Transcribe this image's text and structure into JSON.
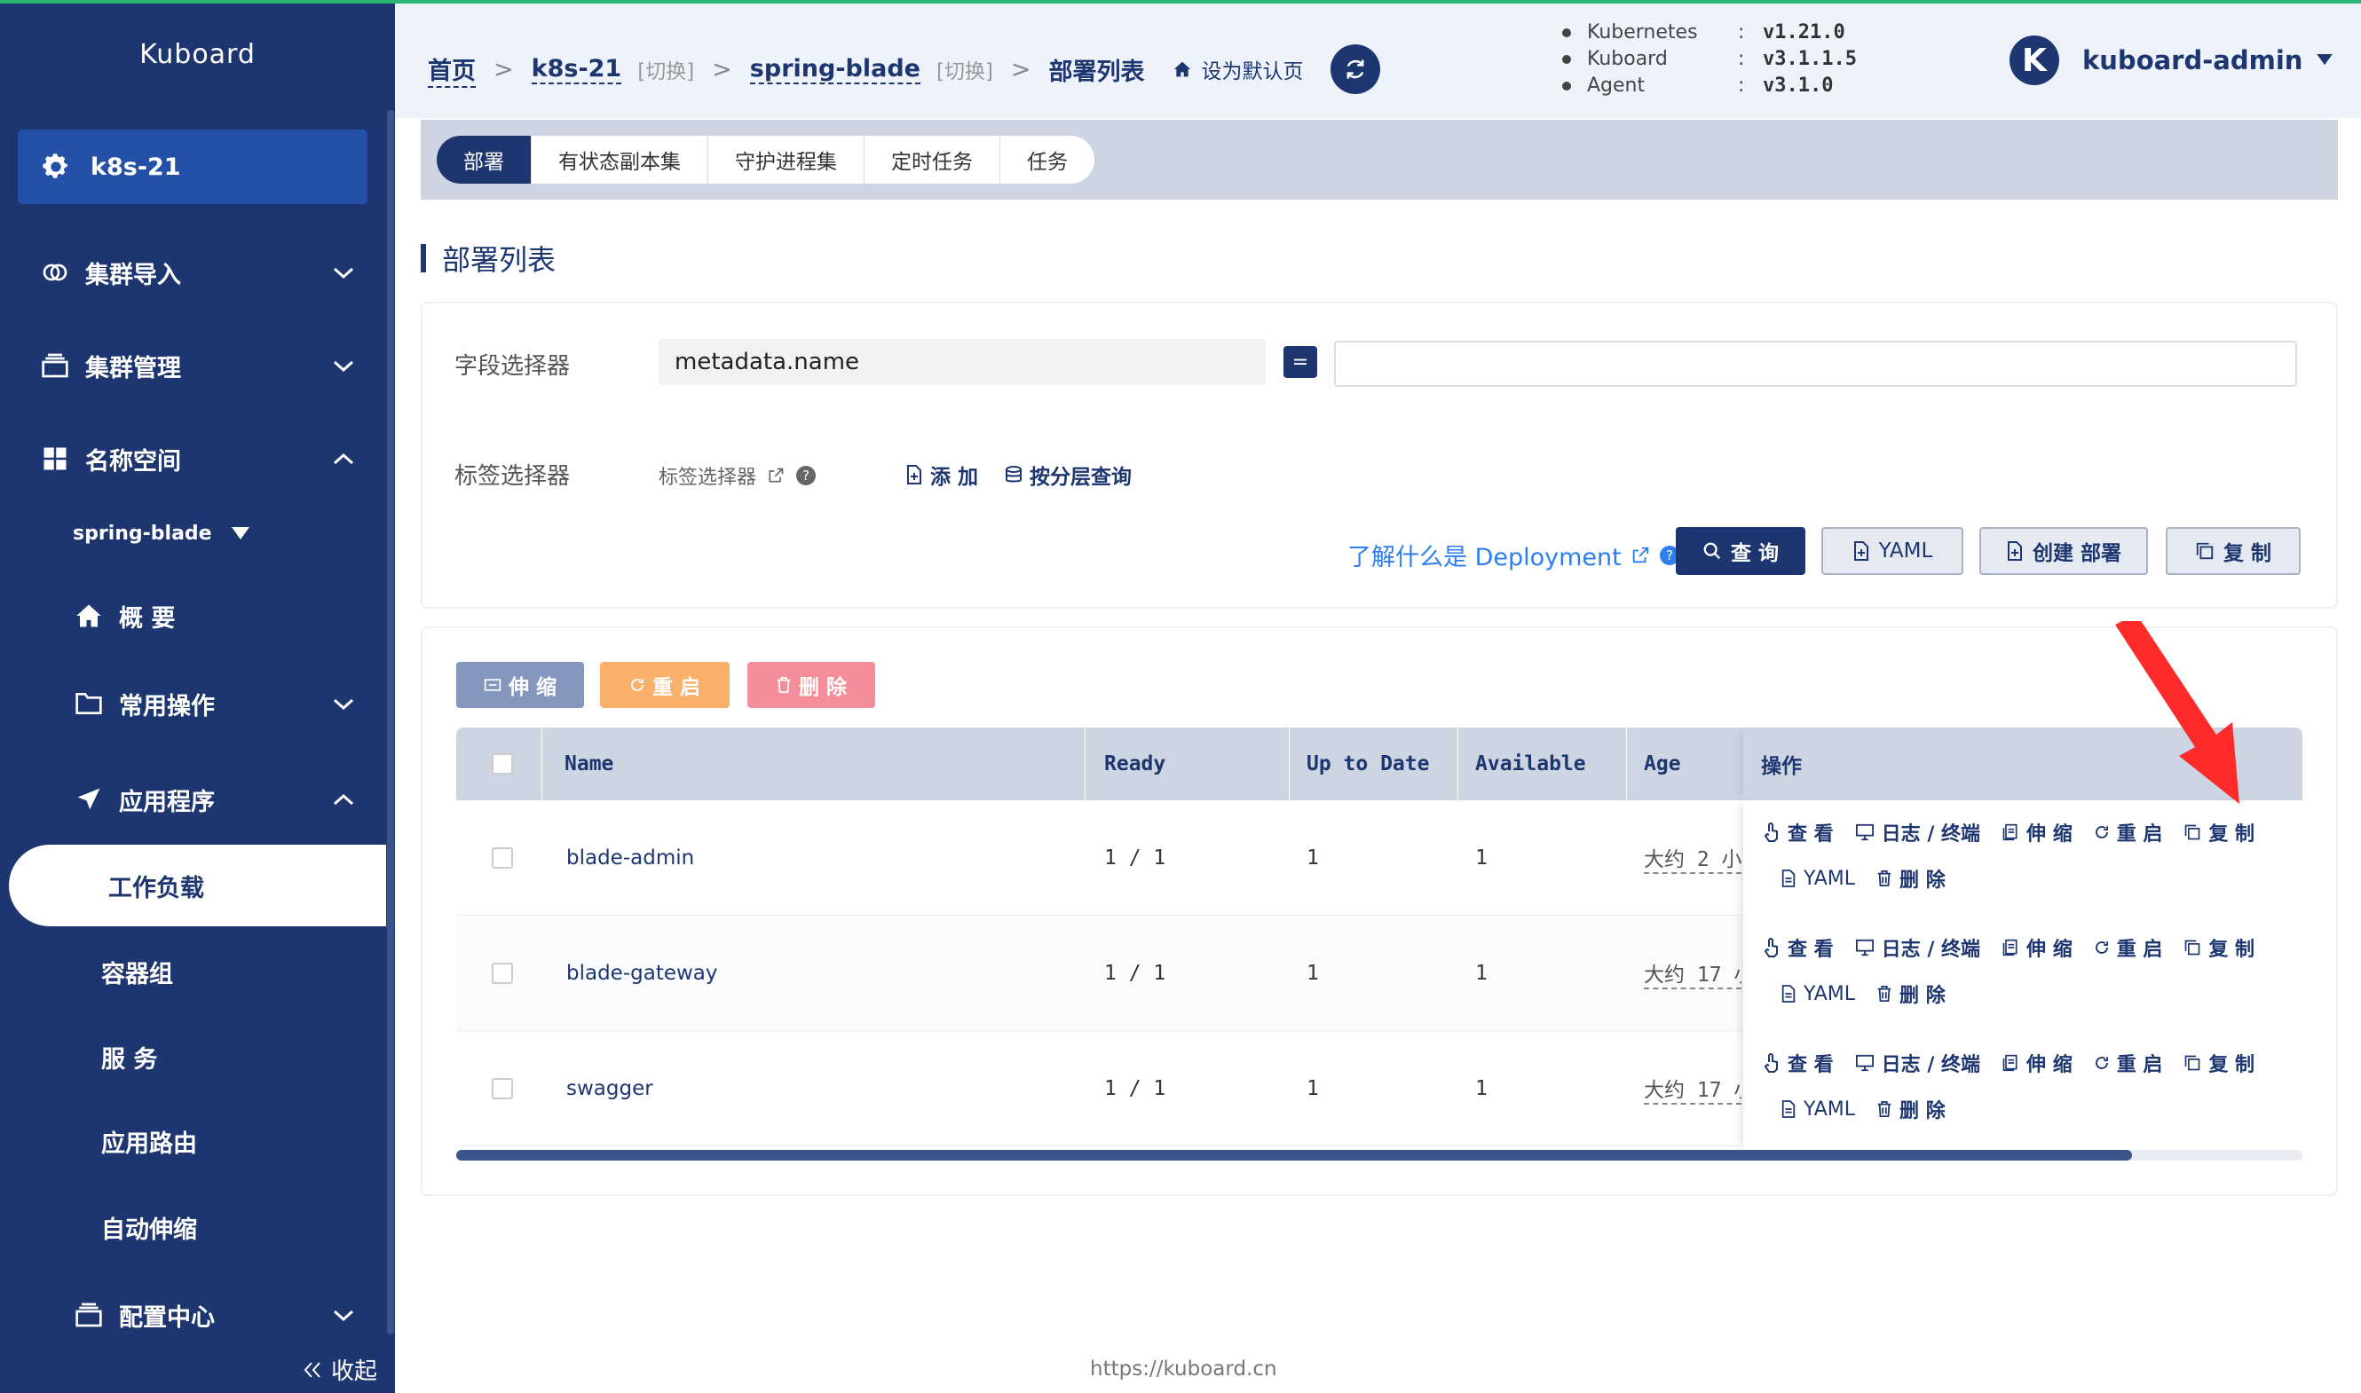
{
  "app": {
    "brand": "Kuboard",
    "cluster": "k8s-21",
    "footer": "https://kuboard.cn"
  },
  "sidebar": {
    "items": [
      {
        "label": "集群导入",
        "icon": "link-icon"
      },
      {
        "label": "集群管理",
        "icon": "stack-icon"
      },
      {
        "label": "名称空间",
        "icon": "grid-icon"
      }
    ],
    "namespace": "spring-blade",
    "ns_items": [
      {
        "label": "概 要",
        "icon": "home-icon"
      },
      {
        "label": "常用操作",
        "icon": "folder-icon"
      },
      {
        "label": "应用程序",
        "icon": "send-icon"
      }
    ],
    "app_items": [
      "工作负载",
      "容器组",
      "服 务",
      "应用路由",
      "自动伸缩"
    ],
    "config_center": "配置中心",
    "collapse": "收起"
  },
  "breadcrumb": {
    "home": "首页",
    "cluster": "k8s-21",
    "switch": "[切换]",
    "namespace": "spring-blade",
    "current": "部署列表",
    "set_default": "设为默认页"
  },
  "versions": [
    {
      "name": "Kubernetes",
      "value": "v1.21.0"
    },
    {
      "name": "Kuboard",
      "value": "v3.1.1.5"
    },
    {
      "name": "Agent",
      "value": "v3.1.0"
    }
  ],
  "user": {
    "initial": "K",
    "name": "kuboard-admin"
  },
  "tabs": [
    "部署",
    "有状态副本集",
    "守护进程集",
    "定时任务",
    "任务"
  ],
  "page_title": "部署列表",
  "filter": {
    "field_label": "字段选择器",
    "field_value": "metadata.name",
    "eq": "=",
    "tag_label": "标签选择器",
    "tag_placeholder": "标签选择器",
    "add": "添 加",
    "layered": "按分层查询",
    "learn": "了解什么是 Deployment",
    "query": "查 询",
    "yaml": "YAML",
    "create": "创建 部署",
    "copy": "复 制"
  },
  "bulk": {
    "scale": "伸 缩",
    "restart": "重 启",
    "delete": "删 除"
  },
  "table": {
    "headers": [
      "Name",
      "Ready",
      "Up to Date",
      "Available",
      "Age",
      "操作"
    ],
    "rows": [
      {
        "name": "blade-admin",
        "ready": "1 / 1",
        "uptodate": "1",
        "available": "1",
        "age": "大约 2 小"
      },
      {
        "name": "blade-gateway",
        "ready": "1 / 1",
        "uptodate": "1",
        "available": "1",
        "age": "大约 17 小"
      },
      {
        "name": "swagger",
        "ready": "1 / 1",
        "uptodate": "1",
        "available": "1",
        "age": "大约 17 小"
      }
    ],
    "ops": {
      "view": "查 看",
      "logs": "日志 / 终端",
      "scale": "伸 缩",
      "restart": "重 启",
      "copy": "复 制",
      "yaml": "YAML",
      "delete": "删 除"
    }
  },
  "colors": {
    "primary": "#1e3670",
    "accent": "#2bb673",
    "link": "#2d7ef0",
    "restart": "#f9b06b",
    "delete": "#f38e9a",
    "scale": "#8597bf",
    "arrow": "#ff2a2a"
  }
}
